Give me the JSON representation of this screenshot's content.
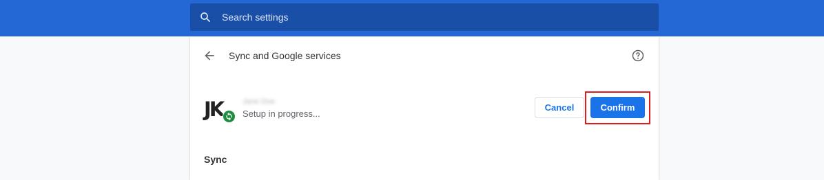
{
  "search": {
    "placeholder": "Search settings",
    "icon": "search-icon"
  },
  "header": {
    "title": "Sync and Google services",
    "back_icon": "arrow-left-icon",
    "help_icon": "help-circle-icon"
  },
  "account": {
    "avatar_text": "JK",
    "name": "Jane Doe",
    "name_blurred": true,
    "status": "Setup in progress...",
    "badge_icon": "sync-icon",
    "badge_color": "#1e8e3e"
  },
  "actions": {
    "cancel_label": "Cancel",
    "confirm_label": "Confirm",
    "confirm_highlighted": true
  },
  "sections": {
    "sync_heading": "Sync"
  },
  "colors": {
    "topbar": "#2468d6",
    "search_box": "#1a4fa8",
    "accent": "#1a73e8",
    "highlight": "#e01b1b",
    "page_background": "#f8f9fa"
  }
}
